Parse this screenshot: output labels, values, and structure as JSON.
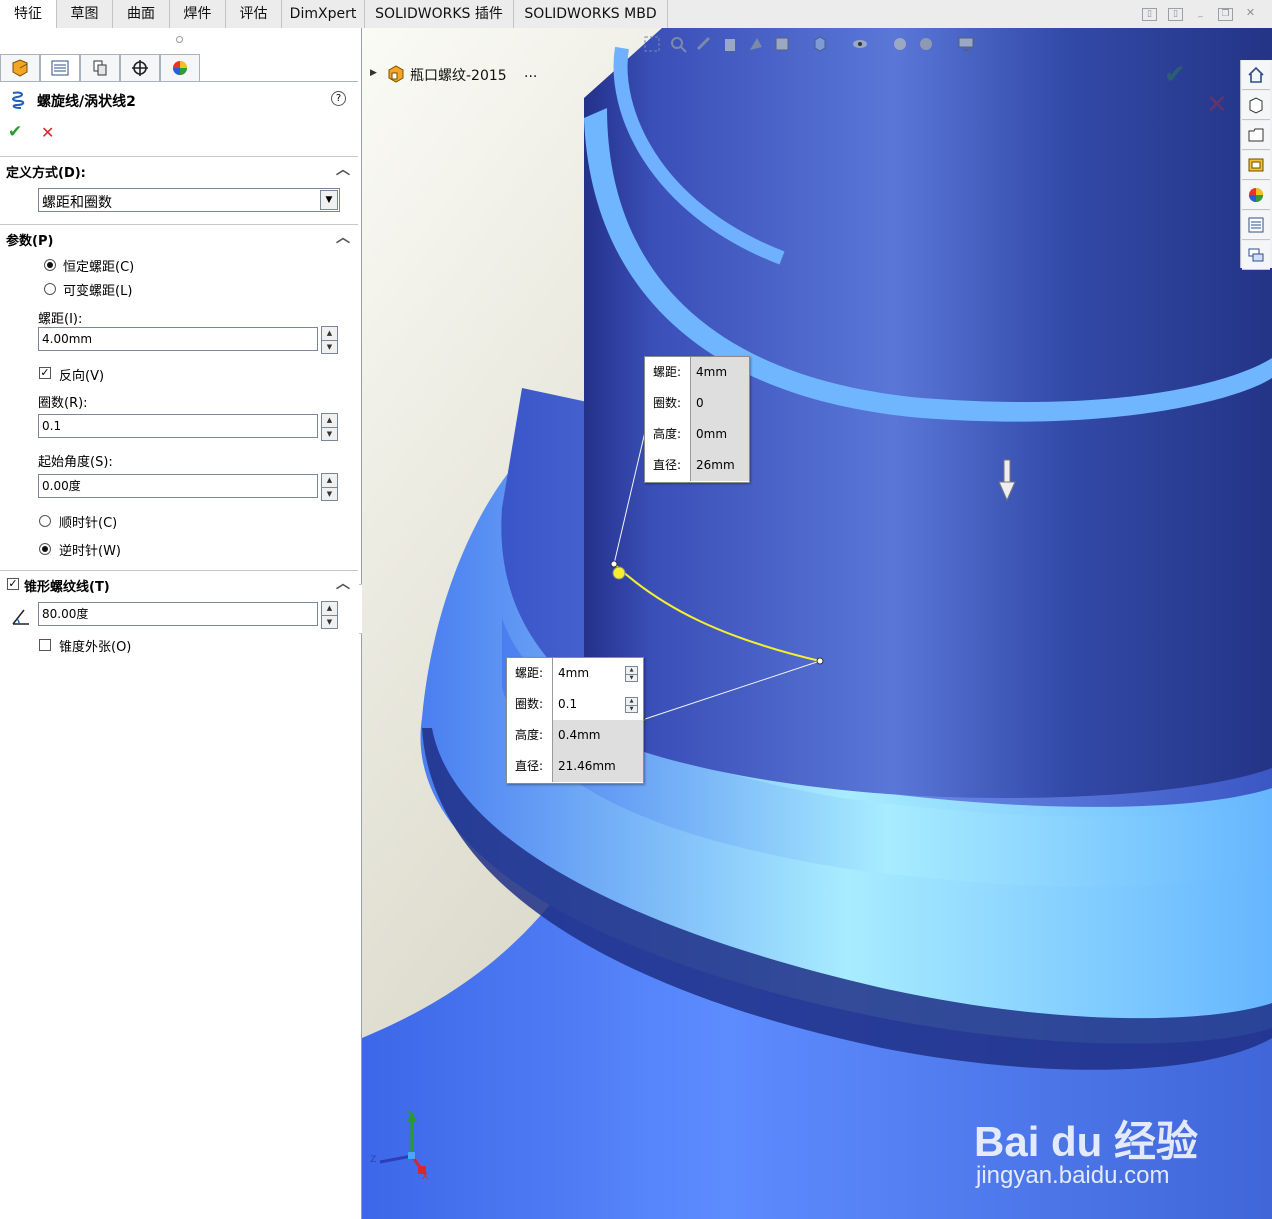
{
  "tabs": [
    "特征",
    "草图",
    "曲面",
    "焊件",
    "评估",
    "DimXpert",
    "SOLIDWORKS 插件",
    "SOLIDWORKS MBD"
  ],
  "active_tab": "特征",
  "feature": {
    "title": "螺旋线/涡状线2",
    "help": "?",
    "ok_glyph": "✔",
    "cancel_glyph": "✕"
  },
  "definition": {
    "title": "定义方式(D):",
    "selected": "螺距和圈数"
  },
  "params": {
    "title": "参数(P)",
    "constant_pitch": "恒定螺距(C)",
    "variable_pitch": "可变螺距(L)",
    "pitch_label": "螺距(I):",
    "pitch_value": "4.00mm",
    "reverse_label": "反向(V)",
    "revolutions_label": "圈数(R):",
    "revolutions_value": "0.1",
    "start_angle_label": "起始角度(S):",
    "start_angle_value": "0.00度",
    "clockwise": "顺时针(C)",
    "counterclockwise": "逆时针(W)"
  },
  "taper": {
    "title": "锥形螺纹线(T)",
    "angle_value": "80.00度",
    "outward_label": "锥度外张(O)"
  },
  "tree": {
    "part_name": "瓶口螺纹-2015",
    "ellipsis": "..."
  },
  "callout_top": {
    "pitch_k": "螺距:",
    "pitch_v": "4mm",
    "rev_k": "圈数:",
    "rev_v": "0",
    "height_k": "高度:",
    "height_v": "0mm",
    "dia_k": "直径:",
    "dia_v": "26mm"
  },
  "callout_bottom": {
    "pitch_k": "螺距:",
    "pitch_v": "4mm",
    "rev_k": "圈数:",
    "rev_v": "0.1",
    "height_k": "高度:",
    "height_v": "0.4mm",
    "dia_k": "直径:",
    "dia_v": "21.46mm"
  },
  "triad": {
    "y": "Y",
    "z": "Z",
    "x": "X"
  },
  "watermark": {
    "main": "Bai du 经验",
    "url": "jingyan.baidu.com"
  },
  "colors": {
    "model_dark": "#28368f",
    "model_mid": "#4a66d6",
    "model_light": "#6fb0ff",
    "helix": "#f5ef2e",
    "ok": "#2c9a2c",
    "cancel": "#d22a2a"
  }
}
